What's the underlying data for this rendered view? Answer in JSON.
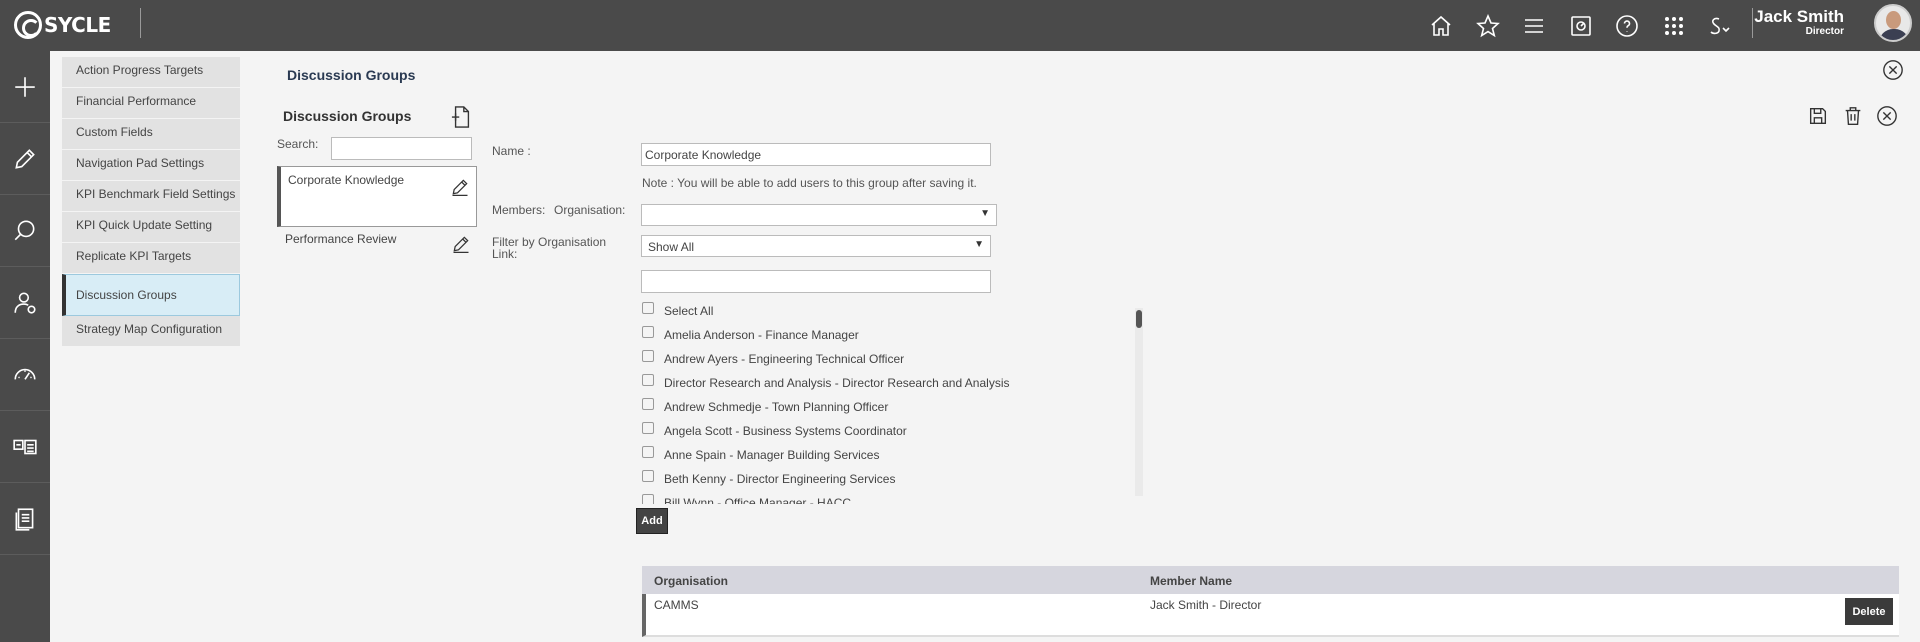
{
  "app": {
    "brand": "SYCLE"
  },
  "header": {
    "user_name": "Jack Smith",
    "user_role": "Director",
    "icons": [
      "home-icon",
      "star-icon",
      "menu-icon",
      "dashboard-icon",
      "help-icon",
      "apps-grid-icon",
      "sycle-dropdown-icon"
    ]
  },
  "rail": {
    "icons": [
      "plus-icon",
      "pencil-icon",
      "search-icon",
      "user-icon",
      "gauge-icon",
      "layout-icon",
      "document-icon"
    ]
  },
  "menu": {
    "items": [
      {
        "label": "Action Progress Targets"
      },
      {
        "label": "Financial Performance"
      },
      {
        "label": "Custom Fields"
      },
      {
        "label": "Navigation Pad Settings"
      },
      {
        "label": "KPI Benchmark Field Settings"
      },
      {
        "label": "KPI Quick Update Setting"
      },
      {
        "label": "Replicate KPI Targets"
      },
      {
        "label": "Discussion Groups",
        "active": true
      },
      {
        "label": "Strategy Map Configuration"
      }
    ]
  },
  "page": {
    "title": "Discussion Groups",
    "panel_title": "Discussion Groups",
    "search_label": "Search:"
  },
  "groups": [
    {
      "name": "Corporate Knowledge",
      "selected": true
    },
    {
      "name": "Performance Review",
      "selected": false
    }
  ],
  "form": {
    "name_label": "Name :",
    "name_value": "Corporate Knowledge",
    "note": "Note : You will be able to add users to this group after saving it.",
    "members_label": "Members:",
    "organisation_label": "Organisation:",
    "organisation_value": "",
    "filter_label": "Filter by Organisation Link:",
    "filter_value": "Show All",
    "member_search_value": "",
    "select_all_label": "Select All",
    "members": [
      "Amelia Anderson - Finance Manager",
      "Andrew Ayers - Engineering Technical Officer",
      "Director Research and Analysis - Director Research and Analysis",
      "Andrew Schmedje - Town Planning Officer",
      "Angela Scott - Business Systems Coordinator",
      "Anne Spain - Manager Building Services",
      "Beth Kenny - Director Engineering Services",
      "Bill Wynn - Office Manager - HACC"
    ],
    "add_label": "Add"
  },
  "grid": {
    "columns": {
      "organisation": "Organisation",
      "member_name": "Member Name"
    },
    "rows": [
      {
        "organisation": "CAMMS",
        "member_name": "Jack Smith - Director",
        "delete_label": "Delete"
      }
    ]
  }
}
